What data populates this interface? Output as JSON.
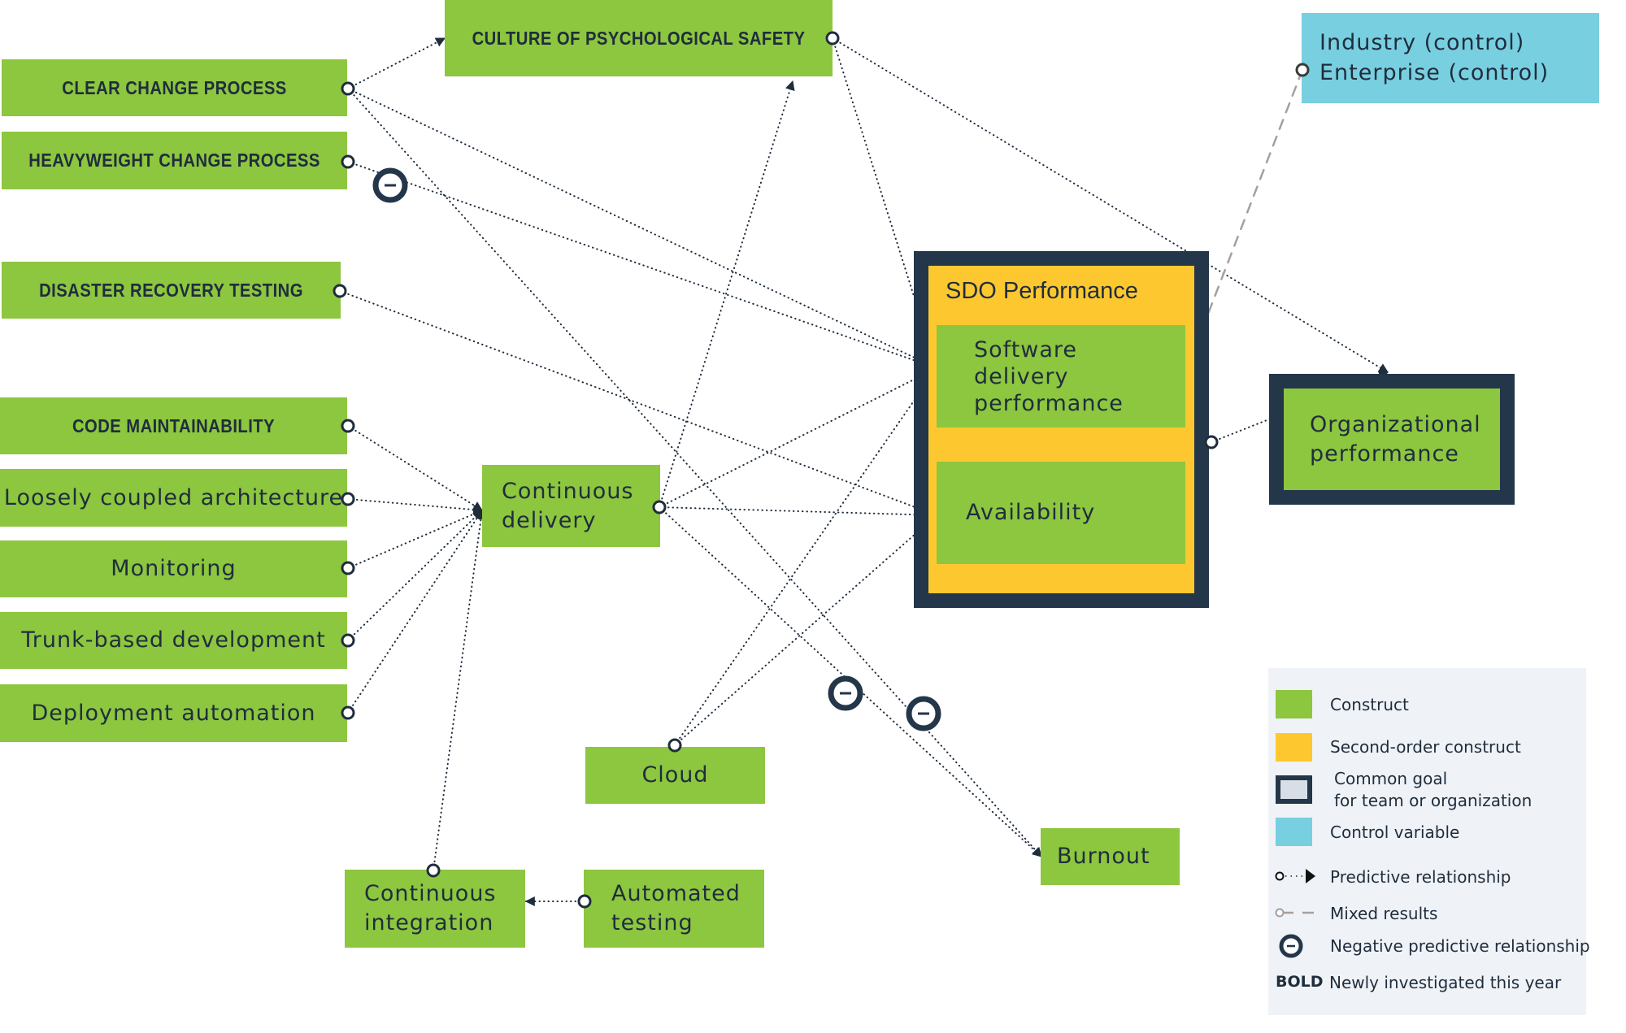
{
  "diagram": {
    "colors": {
      "construct": "#8dc63f",
      "second_order": "#fdc82f",
      "goal_border": "#23364a",
      "control": "#78cfe0",
      "text": "#1f2d3d",
      "line": "#1f2d3d",
      "mixed_line": "#a89f9c",
      "legend_bg": "#eff2f6"
    },
    "nodes": {
      "clear_change": {
        "label": "CLEAR CHANGE PROCESS",
        "newly_investigated": true
      },
      "heavyweight_change": {
        "label": "HEAVYWEIGHT CHANGE PROCESS",
        "newly_investigated": true
      },
      "disaster_recovery": {
        "label": "DISASTER RECOVERY TESTING",
        "newly_investigated": true
      },
      "code_maintainability": {
        "label": "CODE MAINTAINABILITY",
        "newly_investigated": true
      },
      "loosely_coupled": {
        "label": "Loosely coupled architecture"
      },
      "monitoring": {
        "label": "Monitoring"
      },
      "trunk_based": {
        "label": "Trunk-based development"
      },
      "deployment_automation": {
        "label": "Deployment automation"
      },
      "culture": {
        "label": "CULTURE OF PSYCHOLOGICAL SAFETY",
        "newly_investigated": true
      },
      "continuous_delivery": {
        "line1": "Continuous",
        "line2": "delivery"
      },
      "cloud": {
        "label": "Cloud"
      },
      "continuous_integration": {
        "line1": "Continuous",
        "line2": "integration"
      },
      "automated_testing": {
        "line1": "Automated",
        "line2": "testing"
      },
      "burnout": {
        "label": "Burnout"
      },
      "sdo": {
        "title": "SDO Performance"
      },
      "software_delivery": {
        "line1": "Software",
        "line2": "delivery",
        "line3": "performance"
      },
      "availability": {
        "label": "Availability"
      },
      "org_performance": {
        "line1": "Organizational",
        "line2": "performance"
      },
      "control": {
        "line1": "Industry (control)",
        "line2": "Enterprise (control)"
      }
    },
    "edges": [
      {
        "from": "clear_change",
        "to": "culture",
        "type": "predictive"
      },
      {
        "from": "clear_change",
        "to": "software_delivery",
        "type": "predictive"
      },
      {
        "from": "clear_change",
        "to": "burnout",
        "type": "negative"
      },
      {
        "from": "heavyweight_change",
        "to": "software_delivery",
        "type": "negative"
      },
      {
        "from": "disaster_recovery",
        "to": "availability",
        "type": "predictive"
      },
      {
        "from": "culture",
        "to": "software_delivery",
        "type": "predictive"
      },
      {
        "from": "culture",
        "to": "org_performance",
        "type": "predictive"
      },
      {
        "from": "control",
        "to": "software_delivery",
        "type": "mixed"
      },
      {
        "from": "code_maintainability",
        "to": "continuous_delivery",
        "type": "predictive"
      },
      {
        "from": "loosely_coupled",
        "to": "continuous_delivery",
        "type": "predictive"
      },
      {
        "from": "monitoring",
        "to": "continuous_delivery",
        "type": "predictive"
      },
      {
        "from": "trunk_based",
        "to": "continuous_delivery",
        "type": "predictive"
      },
      {
        "from": "deployment_automation",
        "to": "continuous_delivery",
        "type": "predictive"
      },
      {
        "from": "continuous_integration",
        "to": "continuous_delivery",
        "type": "predictive"
      },
      {
        "from": "automated_testing",
        "to": "continuous_integration",
        "type": "predictive"
      },
      {
        "from": "continuous_delivery",
        "to": "culture",
        "type": "predictive"
      },
      {
        "from": "continuous_delivery",
        "to": "software_delivery",
        "type": "predictive"
      },
      {
        "from": "continuous_delivery",
        "to": "availability",
        "type": "predictive"
      },
      {
        "from": "continuous_delivery",
        "to": "burnout",
        "type": "negative"
      },
      {
        "from": "cloud",
        "to": "software_delivery",
        "type": "predictive"
      },
      {
        "from": "cloud",
        "to": "availability",
        "type": "predictive"
      },
      {
        "from": "sdo",
        "to": "org_performance",
        "type": "predictive"
      }
    ]
  },
  "legend": {
    "construct": "Construct",
    "second_order": "Second-order construct",
    "common_goal_line1": "Common goal",
    "common_goal_line2": "for team or organization",
    "control": "Control variable",
    "predictive": "Predictive relationship",
    "mixed": "Mixed results",
    "negative": "Negative predictive relationship",
    "bold_key": "BOLD",
    "bold_desc": "Newly investigated this year"
  }
}
